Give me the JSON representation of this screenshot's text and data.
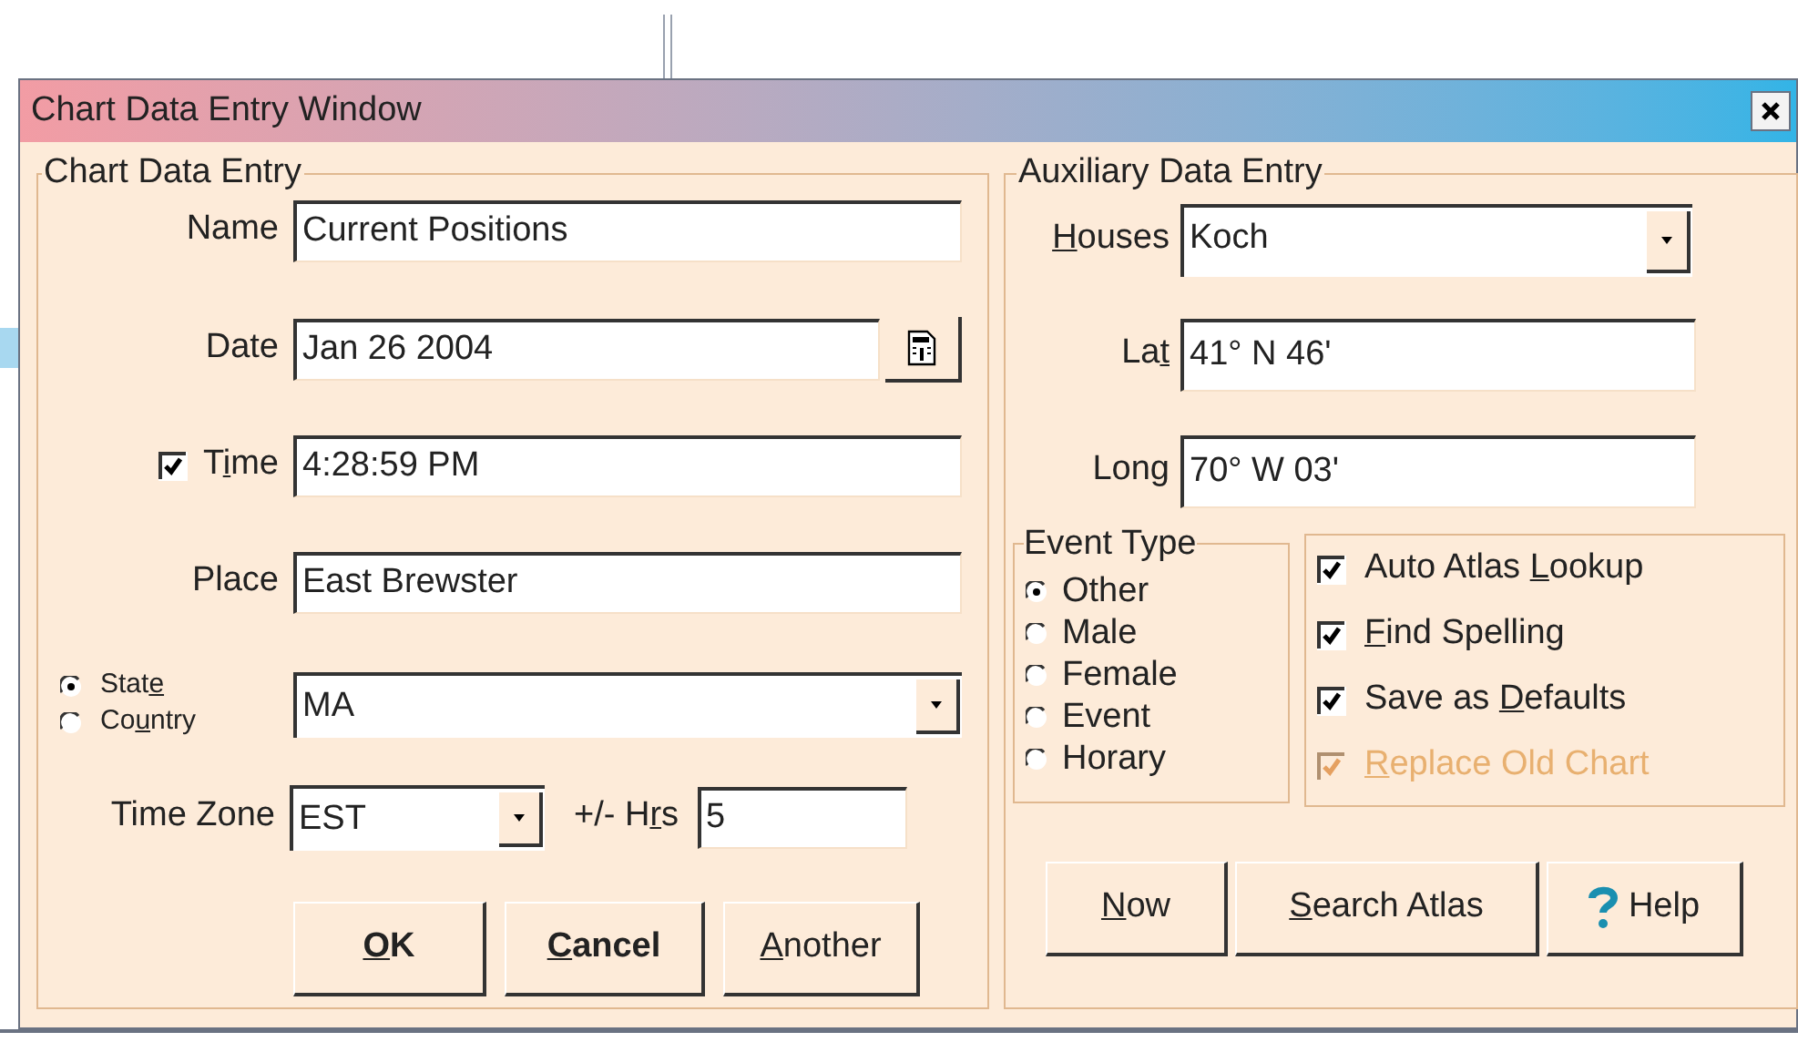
{
  "window": {
    "title": "Chart Data Entry Window"
  },
  "chart_data_entry": {
    "title": "Chart Data Entry",
    "name": {
      "label": "Name",
      "value": "Current Positions"
    },
    "date": {
      "label": "Date",
      "value": "Jan 26 2004"
    },
    "time": {
      "label": {
        "before": "T",
        "key": "i",
        "after": "me"
      },
      "checked": true,
      "value": "4:28:59 PM"
    },
    "place": {
      "label": "Place",
      "value": "East Brewster"
    },
    "region_type": [
      {
        "label": {
          "before": "Stat",
          "key": "e"
        },
        "selected": true
      },
      {
        "label": {
          "before": "Co",
          "key": "u",
          "after": "ntry"
        },
        "selected": false
      }
    ],
    "region": {
      "value": "MA"
    },
    "time_zone": {
      "label": "Time Zone",
      "value": "EST"
    },
    "hours": {
      "label": {
        "before": "+/- H",
        "key": "r",
        "after": "s"
      },
      "value": "5"
    },
    "buttons": [
      {
        "label": {
          "key": "O",
          "after": "K"
        },
        "bold": true
      },
      {
        "label": {
          "key": "C",
          "after": "ancel"
        },
        "bold": true
      },
      {
        "label": {
          "key": "A",
          "after": "nother"
        },
        "bold": false
      }
    ]
  },
  "auxiliary_data_entry": {
    "title": "Auxiliary Data Entry",
    "houses": {
      "label": {
        "key": "H",
        "after": "ouses"
      },
      "value": "Koch"
    },
    "lat": {
      "label": {
        "before": "La",
        "key": "t"
      },
      "value": "41° N 46'"
    },
    "long": {
      "label": {
        "before": "Lon",
        "key": "g"
      },
      "value": "70° W 03'"
    },
    "event_type": {
      "title": "Event Type",
      "options": [
        {
          "label": "Other",
          "selected": true
        },
        {
          "label": "Male",
          "selected": false
        },
        {
          "label": "Female",
          "selected": false
        },
        {
          "label": "Event",
          "selected": false
        },
        {
          "label": "Horary",
          "selected": false
        }
      ]
    },
    "options": [
      {
        "label": {
          "before": "Auto Atlas ",
          "key": "L",
          "after": "ookup"
        },
        "checked": true,
        "disabled": false
      },
      {
        "label": {
          "key": "F",
          "after": "ind Spelling"
        },
        "checked": true,
        "disabled": false
      },
      {
        "label": {
          "before": "Save as ",
          "key": "D",
          "after": "efaults"
        },
        "checked": true,
        "disabled": false
      },
      {
        "label": {
          "key": "R",
          "after": "eplace Old Chart"
        },
        "checked": true,
        "disabled": true
      }
    ],
    "buttons": [
      {
        "label": {
          "key": "N",
          "after": "ow"
        },
        "kind": "text"
      },
      {
        "label": {
          "key": "S",
          "after": "earch Atlas"
        },
        "kind": "text"
      },
      {
        "label": "Help",
        "kind": "help"
      }
    ]
  }
}
